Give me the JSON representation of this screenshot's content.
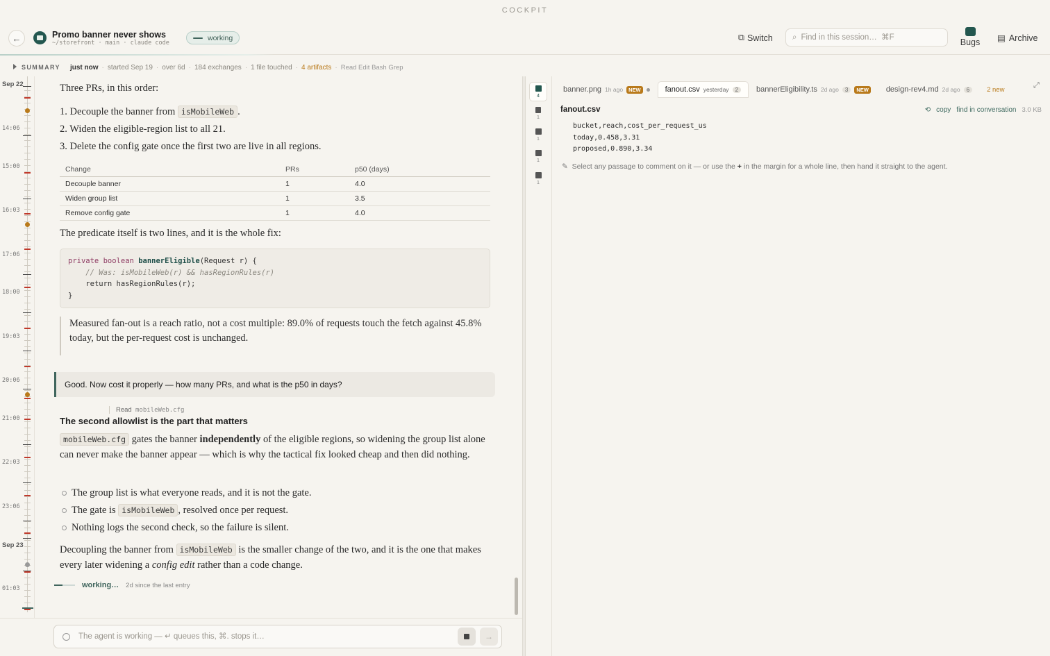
{
  "brand": "COCKPIT",
  "header": {
    "title": "Promo banner never shows",
    "subtitle": "~/storefront · main · claude code",
    "status": "working",
    "switch_label": "Switch",
    "search_placeholder": "Find in this session…  ⌘F",
    "bugs_label": "Bugs",
    "archive_label": "Archive"
  },
  "summary": {
    "toggle": "SUMMARY",
    "updated": "just now",
    "started": "started Sep 19",
    "duration": "over 6d",
    "exchanges": "184 exchanges",
    "files": "1 file touched",
    "artifacts": "4 artifacts",
    "tools": "Read Edit Bash Grep"
  },
  "timeline": {
    "labels": [
      {
        "text": "Sep 22",
        "date": true
      },
      {
        "text": "14:06"
      },
      {
        "text": "15:00"
      },
      {
        "text": "16:03"
      },
      {
        "text": "17:06"
      },
      {
        "text": "18:00"
      },
      {
        "text": "19:03"
      },
      {
        "text": "20:06"
      },
      {
        "text": "21:00"
      },
      {
        "text": "22:03"
      },
      {
        "text": "23:06"
      },
      {
        "text": "Sep 23",
        "date": true
      },
      {
        "text": "01:03"
      }
    ]
  },
  "chat": {
    "intro": "Three PRs, in this order:",
    "steps": [
      {
        "n": "1.",
        "pre": "Decouple the banner from ",
        "code": "isMobileWeb",
        "post": "."
      },
      {
        "n": "2.",
        "pre": "Widen the eligible-region list to all 21.",
        "code": "",
        "post": ""
      },
      {
        "n": "3.",
        "pre": "Delete the config gate once the first two are live in all regions.",
        "code": "",
        "post": ""
      }
    ],
    "table": {
      "headers": [
        "Change",
        "PRs",
        "p50 (days)"
      ],
      "rows": [
        [
          "Decouple banner",
          "1",
          "4.0"
        ],
        [
          "Widen group list",
          "1",
          "3.5"
        ],
        [
          "Remove config gate",
          "1",
          "4.0"
        ]
      ]
    },
    "predicate_text": "The predicate itself is two lines, and it is the whole fix:",
    "code": {
      "kw1": "private",
      "kw2": "boolean",
      "fn": "bannerEligible",
      "sig": "(Request r) {",
      "comment": "// Was: isMobileWeb(r) && hasRegionRules(r)",
      "kw3": "return",
      "ret": " hasRegionRules(r);",
      "close": "}"
    },
    "quote": "Measured fan-out is a reach ratio, not a cost multiple: 89.0% of requests touch the fetch against 45.8% today, but the per-request cost is unchanged.",
    "user_message": "Good. Now cost it properly — how many PRs, and what is the p50 in days?",
    "read_label": "Read",
    "read_file": "mobileWeb.cfg",
    "heading": "The second allowlist is the part that matters",
    "para1": {
      "code": "mobileWeb.cfg",
      "a": " gates the banner ",
      "b": "independently",
      "c": " of the eligible regions, so widening the group list alone can never make the banner appear — which is why the tactical fix looked cheap and then did nothing."
    },
    "bullets": [
      {
        "pre": "The group list is what everyone reads, and it is not the gate.",
        "code": "",
        "post": ""
      },
      {
        "pre": "The gate is ",
        "code": "isMobileWeb",
        "post": ", resolved once per request."
      },
      {
        "pre": "Nothing logs the second check, so the failure is silent.",
        "code": "",
        "post": ""
      }
    ],
    "para2": {
      "a": "Decoupling the banner from ",
      "code": "isMobileWeb",
      "b": " is the smaller change of the two, and it is the one that makes every later widening a ",
      "em": "config edit",
      "c": " rather than a code change."
    },
    "working": "working…",
    "since": "2d since the last entry"
  },
  "composer": {
    "placeholder": "The agent is working — ↵ queues this, ⌘. stops it…"
  },
  "rail": [
    {
      "count": "4"
    },
    {
      "count": "1"
    },
    {
      "count": "1"
    },
    {
      "count": "1"
    },
    {
      "count": "1"
    }
  ],
  "tabs": [
    {
      "name": "banner.png",
      "age": "1h ago",
      "badge": "NEW",
      "num": "",
      "dot": true
    },
    {
      "name": "fanout.csv",
      "age": "yesterday",
      "badge": "",
      "num": "2",
      "dot": false
    },
    {
      "name": "bannerEligibility.ts",
      "age": "2d ago",
      "badge": "NEW",
      "num": "3",
      "dot": false
    },
    {
      "name": "design-rev4.md",
      "age": "2d ago",
      "badge": "",
      "num": "6",
      "dot": false
    }
  ],
  "new_count": "2 new",
  "file": {
    "name": "fanout.csv",
    "copy": "copy",
    "find": "find in conversation",
    "size": "3.0 KB",
    "lines": [
      "bucket,reach,cost_per_request_us",
      "today,0.458,3.31",
      "proposed,0.890,3.34"
    ],
    "hint_a": "Select any passage to comment on it — or use the ",
    "hint_plus": "+",
    "hint_b": " in the margin for a whole line, then hand it straight to the agent."
  }
}
